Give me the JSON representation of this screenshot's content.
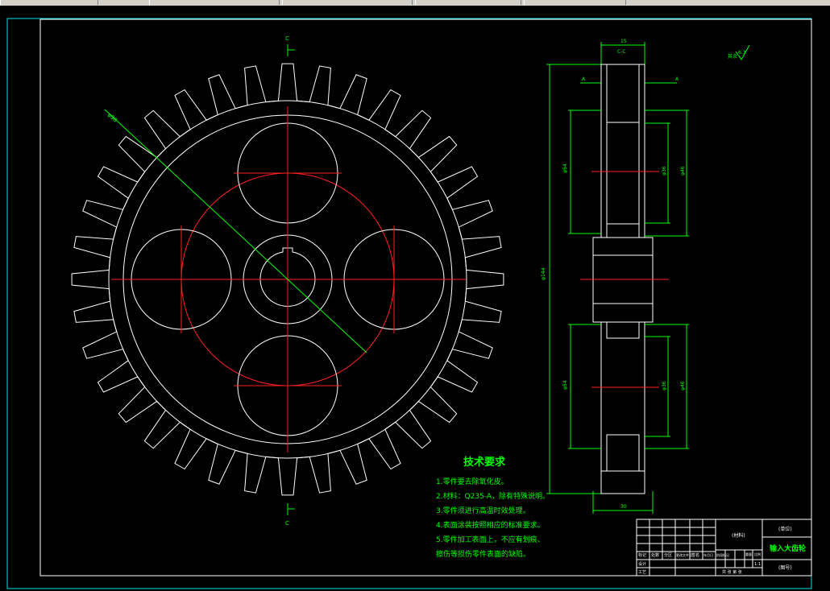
{
  "drawing": {
    "requirements_title": "技术要求",
    "requirements": [
      "1.零件要去除氧化皮。",
      "2.材料：Q235-A，除有特殊说明。",
      "3.零件须进行高温时效处理。",
      "4.表面涂装按照相应的标准要求。",
      "5.零件加工表面上，不应有划痕、",
      "擦伤等损伤零件表面的缺陷。"
    ],
    "roughness_label": "其余",
    "roughness_value": "6.3",
    "section_label": "C-C",
    "cut_label_top": "C",
    "cut_label_bottom": "C",
    "section_marker_a": "A",
    "section_marker_b": "A",
    "dim_top_width": "15",
    "dim_bottom_width": "30",
    "dim_outer_diameter": "φ144",
    "dim_left_upper": "φ54",
    "dim_right_upper_inner": "φ36",
    "dim_right_upper_outer": "φ46",
    "dim_left_lower": "φ54",
    "dim_right_lower_inner": "φ36",
    "dim_right_lower_outer": "φ46",
    "dim_diag": "φ98"
  },
  "title_block": {
    "part_name": "输入大齿轮",
    "material_cell": "(材料)",
    "company_cell": "(单位)",
    "drawing_no": "(图号)",
    "scale": "1:1",
    "labels": [
      "标记",
      "处数",
      "分区",
      "更改文件号",
      "签名",
      "年月日"
    ],
    "stage_label": "阶段标记",
    "weight_label": "重量",
    "ratio_label": "比例",
    "design_label": "设计",
    "process_label": "工艺",
    "sheet_label": "共 张 第 张"
  }
}
